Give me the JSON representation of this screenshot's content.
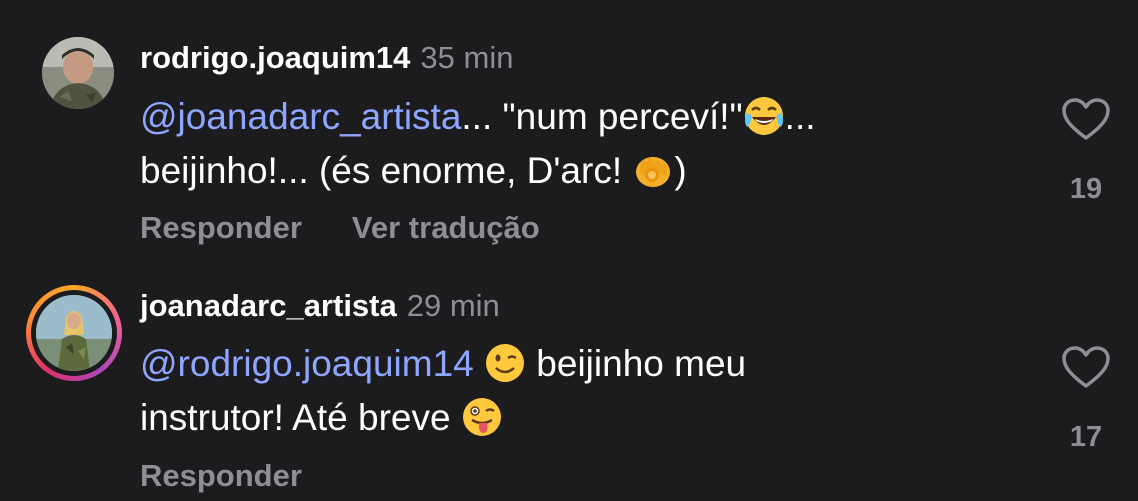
{
  "comments": [
    {
      "username": "rodrigo.joaquim14",
      "time": "35 min",
      "mention": "@joanadarc_artista",
      "text_part1": "... \"num perceví!\"",
      "text_part2": "...",
      "text_part3": "beijinho!... (és enorme, D'arc! ",
      "text_part4": ")",
      "reply_label": "Responder",
      "translate_label": "Ver tradução",
      "like_count": "19",
      "emojis": [
        "face-with-tears-of-joy",
        "backhand-index-pointing-at-viewer"
      ]
    },
    {
      "username": "joanadarc_artista",
      "time": "29 min",
      "mention": "@rodrigo.joaquim14",
      "text_part1": " beijinho meu",
      "text_part2": "instrutor! Até breve ",
      "reply_label": "Responder",
      "like_count": "17",
      "emojis": [
        "winking-face",
        "winking-face-with-tongue"
      ]
    }
  ],
  "colors": {
    "background": "#1c1c1e",
    "mention": "#8fa6ff",
    "secondary": "#8e8e93",
    "text": "#ffffff"
  }
}
